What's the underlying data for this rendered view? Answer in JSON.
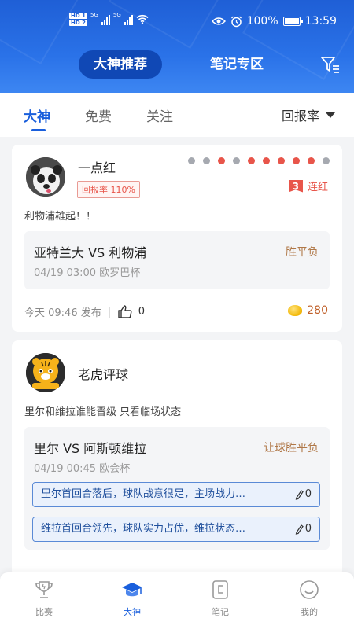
{
  "status_bar": {
    "hd1": "HD 1",
    "hd2": "HD 2",
    "net1": "5G",
    "net2": "5G",
    "battery": "100%",
    "time": "13:59"
  },
  "header": {
    "tab_active": "大神推荐",
    "tab_other": "笔记专区",
    "filter_icon": "filter-list-icon"
  },
  "tabs": {
    "items": [
      "大神",
      "免费",
      "关注"
    ],
    "active": "大神",
    "sort_label": "回报率"
  },
  "colors": {
    "primary": "#1a5fdc",
    "accent_red": "#e8554a",
    "dot_grey": "#a6a9b0",
    "dot_red": "#e8554a",
    "odds_brown": "#b07848"
  },
  "cards": [
    {
      "author": "一点红",
      "rate_badge": "回报率 110%",
      "form_dots": [
        "grey",
        "grey",
        "red",
        "grey",
        "red",
        "red",
        "red",
        "red",
        "red",
        "grey"
      ],
      "streak_num": "3",
      "streak_label": "连红",
      "desc": "利物浦雄起！！",
      "match": {
        "teams": "亚特兰大 VS 利物浦",
        "time": "04/19 03:00 欧罗巴杯",
        "type": "胜平负"
      },
      "publish_time": "今天 09:46 发布",
      "likes": "0",
      "price": "280"
    },
    {
      "author": "老虎评球",
      "desc": "里尔和维拉谁能晋级 只看临场状态",
      "match": {
        "teams": "里尔 VS 阿斯顿维拉",
        "time": "04/19 00:45 欧会杯",
        "type": "让球胜平负"
      },
      "picks": [
        {
          "text": "里尔首回合落后，球队战意很足，主场战力…",
          "count": "0"
        },
        {
          "text": "维拉首回合领先，球队实力占优，维拉状态…",
          "count": "0"
        }
      ]
    }
  ],
  "bottom_nav": [
    {
      "label": "比赛",
      "icon": "trophy-icon"
    },
    {
      "label": "大神",
      "icon": "graduation-cap-icon"
    },
    {
      "label": "笔记",
      "icon": "notebook-icon"
    },
    {
      "label": "我的",
      "icon": "smiley-icon"
    }
  ]
}
